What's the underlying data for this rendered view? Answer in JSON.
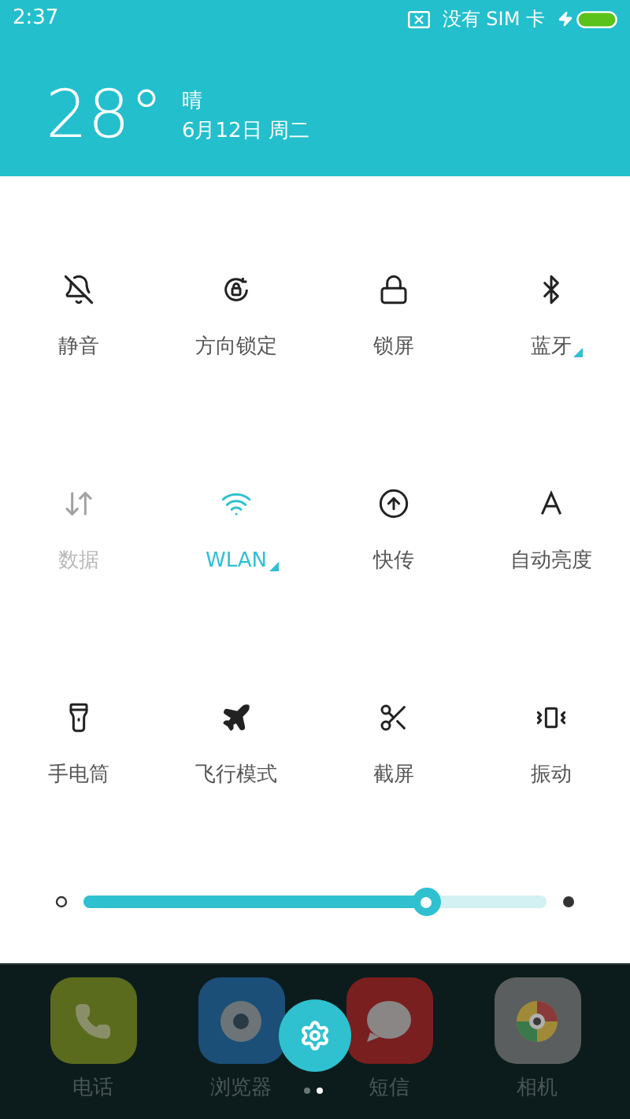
{
  "status_bar": {
    "time": "2:37",
    "sim_text": "没有 SIM 卡",
    "charging": true
  },
  "weather": {
    "temperature": "28°",
    "condition": "晴",
    "date": "6月12日 周二"
  },
  "toggles": [
    {
      "kind": "mute",
      "label": "静音",
      "on": false,
      "disabled": false,
      "expandable": false
    },
    {
      "kind": "rotation",
      "label": "方向锁定",
      "on": false,
      "disabled": false,
      "expandable": false
    },
    {
      "kind": "lock",
      "label": "锁屏",
      "on": false,
      "disabled": false,
      "expandable": false
    },
    {
      "kind": "bluetooth",
      "label": "蓝牙",
      "on": false,
      "disabled": false,
      "expandable": true
    },
    {
      "kind": "data",
      "label": "数据",
      "on": false,
      "disabled": true,
      "expandable": false
    },
    {
      "kind": "wifi",
      "label": "WLAN",
      "on": true,
      "disabled": false,
      "expandable": true
    },
    {
      "kind": "transfer",
      "label": "快传",
      "on": false,
      "disabled": false,
      "expandable": false
    },
    {
      "kind": "auto_brightness",
      "label": "自动亮度",
      "on": false,
      "disabled": false,
      "expandable": false
    },
    {
      "kind": "flashlight",
      "label": "手电筒",
      "on": false,
      "disabled": false,
      "expandable": false
    },
    {
      "kind": "airplane",
      "label": "飞行模式",
      "on": false,
      "disabled": false,
      "expandable": false
    },
    {
      "kind": "screenshot",
      "label": "截屏",
      "on": false,
      "disabled": false,
      "expandable": false
    },
    {
      "kind": "vibrate",
      "label": "振动",
      "on": false,
      "disabled": false,
      "expandable": false
    }
  ],
  "brightness": {
    "level": 0.74
  },
  "dock": [
    {
      "kind": "phone",
      "label": "电话",
      "color": "#5a6b1e"
    },
    {
      "kind": "browser",
      "label": "浏览器",
      "color": "#1b4f78"
    },
    {
      "kind": "messages",
      "label": "短信",
      "color": "#7a1f1f"
    },
    {
      "kind": "camera",
      "label": "相机",
      "color": "#5a5e5e"
    }
  ],
  "page_dots": [
    {
      "selected": false
    },
    {
      "selected": true
    }
  ]
}
